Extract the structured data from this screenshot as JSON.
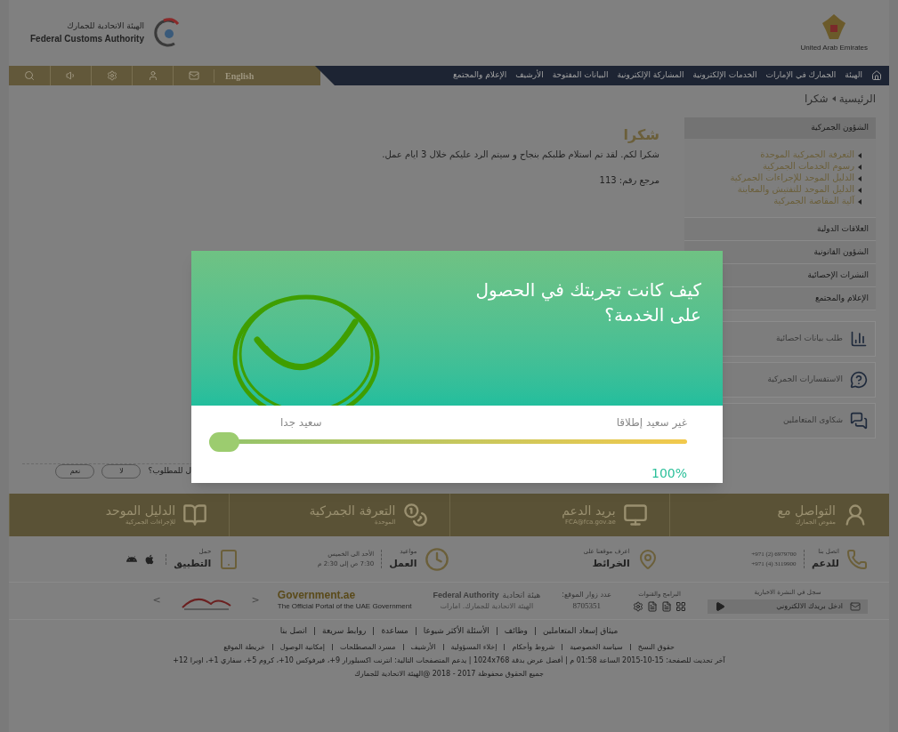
{
  "header": {
    "logo_ar": "الهيئة الاتحادية للجمارك",
    "logo_en": "Federal Customs Authority",
    "emblem_caption": "United Arab Emirates"
  },
  "toolbar": {
    "language": "English"
  },
  "nav": [
    "الهيئة",
    "الجمارك في الإمارات",
    "الخدمات الإلكترونية",
    "المشاركة الإلكترونية",
    "البيانات المفتوحة",
    "الأرشيف",
    "الإعلام والمجتمع"
  ],
  "breadcrumb": [
    "الرئيسية",
    "شكرا"
  ],
  "sidebar": {
    "sections": [
      {
        "label": "الشؤون الجمركية",
        "expanded": true,
        "children": [
          {
            "label": "التعرفة الجمركية الموحدة"
          },
          {
            "label": "رسوم الخدمات الجمركية"
          },
          {
            "label": "الدليل الموحد للإجراءات الجمركية"
          },
          {
            "label": "الدليل الموحد للتفتيش والمعاينة"
          },
          {
            "label": "آلية المقاصة الجمركية"
          }
        ]
      },
      {
        "label": "العلاقات الدولية",
        "expanded": false
      },
      {
        "label": "الشؤون القانونية",
        "expanded": false
      },
      {
        "label": "النشرات الإحصائية",
        "expanded": false
      },
      {
        "label": "الإعلام والمجتمع",
        "expanded": false
      }
    ],
    "services": [
      {
        "kind": "chart",
        "label": "طلب بيانات احصائية"
      },
      {
        "kind": "question",
        "label": "الاستفسارات الجمركية"
      },
      {
        "kind": "complaint",
        "label": "شكاوى المتعاملين"
      }
    ]
  },
  "content": {
    "title": "شكرا",
    "message": "شكرا لكم. لقد تم استلام طلبكم بنجاح و سيتم الرد عليكم خلال 3 ايام عمل.",
    "reference": "مرجع رقم: 113"
  },
  "feedback": {
    "question": "ل للمطلوب؟",
    "buttons": [
      "لا",
      "نعم"
    ]
  },
  "modal": {
    "title": "كيف كانت تجربتك في الحصول على الخدمة؟",
    "label_low": "غير سعيد إطلاقا",
    "label_high": "سعيد جدا",
    "slider": {
      "level": 1
    },
    "percent": "100%"
  },
  "banner": [
    {
      "kind": "user",
      "title": "التواصل مع",
      "subtitle": "مفوض الجمارك"
    },
    {
      "kind": "monitor",
      "title": "بريد الدعم",
      "subtitle": "FCA@fca.gov.ae"
    },
    {
      "kind": "coins",
      "title": "التعرفة الجمركية",
      "subtitle": "الموحدة"
    },
    {
      "kind": "book",
      "title": "الدليل الموحد",
      "subtitle": "للإجراءات الجمركية"
    }
  ],
  "info": {
    "support": {
      "small": "اتصل بنا",
      "big": "للدعم",
      "phones": [
        "+971 (2) 6979700",
        "+971 (4) 3119900"
      ]
    },
    "map": {
      "small": "اعرف موقعنا على",
      "big": "الخرائط"
    },
    "hours": {
      "small": "مواعيد",
      "big": "العمل",
      "days": "الأحد الى الخميس",
      "time": "7:30 ص إلى 2:30 م"
    },
    "app": {
      "small": "حمل",
      "big": "التطبيق"
    }
  },
  "partners": {
    "newsletter_label": "سجل في النشرة الاخبارية",
    "newsletter_placeholder": "ادخل بريدك الالكتروني",
    "channels_label": "البرامج والقنوات",
    "visitors_label": "عدد زوار الموقع:",
    "visitors": "8705351",
    "authority_ar": "هيئة اتحادية",
    "authority_en": "Federal Authority",
    "authority_name": "الهيئة الاتحادية للجمارك. امارات",
    "gov": "Government.ae",
    "gov_sub": "The Official Portal of the UAE Government",
    "next": ">",
    "prev": "<"
  },
  "footer": {
    "main_links": [
      "ميثاق إسعاد المتعاملين",
      "وظائف",
      "الأسئلة الأكثر شيوعا",
      "مساعدة",
      "روابط سريعة",
      "اتصل بنا"
    ],
    "links": [
      "حقوق النسخ",
      "سياسة الخصوصية",
      "شروط وأحكام",
      "إخلاء المسؤولية",
      "الأرشيف",
      "مسرد المصطلحات",
      "إمكانية الوصول",
      "خريطة الموقع"
    ],
    "updated": "آخر تحديث للصفحة: 15-10-2015 الساعة 01:58 م | أفضل عرض بدقة 1024x768 | يدعم المتصفحات التالية: انترنت اكسبلورار 9+، فيرفوكس 10+، كروم 5+، سفاري 1+، اوبرا 12+",
    "copyright": "جميع الحقوق محفوظة 2017 - 2018 @الهيئة الاتحادية للجمارك"
  }
}
